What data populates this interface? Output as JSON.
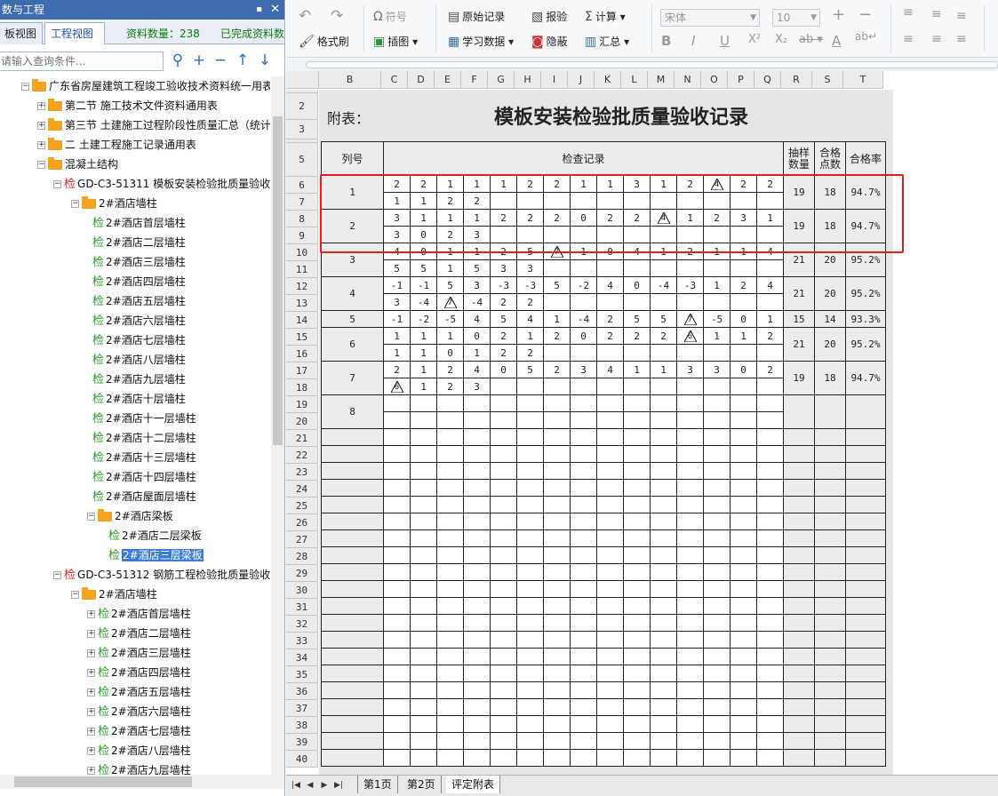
{
  "left_panel": {
    "title": "数与工程",
    "pin": "▪",
    "close": "✕",
    "tabs": [
      "板视图",
      "工程视图"
    ],
    "stats": [
      "资料数量：238",
      "已完成资料数"
    ],
    "search_placeholder": "请输入查询条件..."
  },
  "tree": [
    {
      "indent": 24,
      "type": "folder",
      "toggle": "−",
      "label": "广东省房屋建筑工程竣工验收技术资料统一用表"
    },
    {
      "indent": 42,
      "type": "folder",
      "toggle": "+",
      "label": "第二节 施工技术文件资料通用表"
    },
    {
      "indent": 42,
      "type": "folder",
      "toggle": "+",
      "label": "第三节 土建施工过程阶段性质量汇总（统计"
    },
    {
      "indent": 42,
      "type": "folder",
      "toggle": "+",
      "label": "二 土建工程施工记录通用表"
    },
    {
      "indent": 42,
      "type": "folder",
      "toggle": "−",
      "label": "混凝土结构"
    },
    {
      "indent": 60,
      "type": "jianr",
      "toggle": "−",
      "label": "GD-C3-51311 模板安装检验批质量验收记"
    },
    {
      "indent": 80,
      "type": "folder",
      "toggle": "−",
      "label": "2#酒店墙柱"
    },
    {
      "indent": 104,
      "type": "jian",
      "toggle": "",
      "label": "2#酒店首层墙柱"
    },
    {
      "indent": 104,
      "type": "jian",
      "toggle": "",
      "label": "2#酒店二层墙柱"
    },
    {
      "indent": 104,
      "type": "jian",
      "toggle": "",
      "label": "2#酒店三层墙柱"
    },
    {
      "indent": 104,
      "type": "jian",
      "toggle": "",
      "label": "2#酒店四层墙柱"
    },
    {
      "indent": 104,
      "type": "jian",
      "toggle": "",
      "label": "2#酒店五层墙柱"
    },
    {
      "indent": 104,
      "type": "jian",
      "toggle": "",
      "label": "2#酒店六层墙柱"
    },
    {
      "indent": 104,
      "type": "jian",
      "toggle": "",
      "label": "2#酒店七层墙柱"
    },
    {
      "indent": 104,
      "type": "jian",
      "toggle": "",
      "label": "2#酒店八层墙柱"
    },
    {
      "indent": 104,
      "type": "jian",
      "toggle": "",
      "label": "2#酒店九层墙柱"
    },
    {
      "indent": 104,
      "type": "jian",
      "toggle": "",
      "label": "2#酒店十层墙柱"
    },
    {
      "indent": 104,
      "type": "jian",
      "toggle": "",
      "label": "2#酒店十一层墙柱"
    },
    {
      "indent": 104,
      "type": "jian",
      "toggle": "",
      "label": "2#酒店十二层墙柱"
    },
    {
      "indent": 104,
      "type": "jian",
      "toggle": "",
      "label": "2#酒店十三层墙柱"
    },
    {
      "indent": 104,
      "type": "jian",
      "toggle": "",
      "label": "2#酒店十四层墙柱"
    },
    {
      "indent": 104,
      "type": "jian",
      "toggle": "",
      "label": "2#酒店屋面层墙柱"
    },
    {
      "indent": 98,
      "type": "folder",
      "toggle": "−",
      "label": "2#酒店梁板"
    },
    {
      "indent": 122,
      "type": "jian",
      "toggle": "",
      "label": "2#酒店二层梁板"
    },
    {
      "indent": 122,
      "type": "jian",
      "toggle": "",
      "label": "2#酒店三层梁板",
      "selected": true
    },
    {
      "indent": 60,
      "type": "jianr",
      "toggle": "−",
      "label": "GD-C3-51312 钢筋工程检验批质量验收记"
    },
    {
      "indent": 80,
      "type": "folder",
      "toggle": "−",
      "label": "2#酒店墙柱"
    },
    {
      "indent": 98,
      "type": "jian",
      "toggle": "+",
      "label": "2#酒店首层墙柱"
    },
    {
      "indent": 98,
      "type": "jian",
      "toggle": "+",
      "label": "2#酒店二层墙柱"
    },
    {
      "indent": 98,
      "type": "jian",
      "toggle": "+",
      "label": "2#酒店三层墙柱"
    },
    {
      "indent": 98,
      "type": "jian",
      "toggle": "+",
      "label": "2#酒店四层墙柱"
    },
    {
      "indent": 98,
      "type": "jian",
      "toggle": "+",
      "label": "2#酒店五层墙柱"
    },
    {
      "indent": 98,
      "type": "jian",
      "toggle": "+",
      "label": "2#酒店六层墙柱"
    },
    {
      "indent": 98,
      "type": "jian",
      "toggle": "+",
      "label": "2#酒店七层墙柱"
    },
    {
      "indent": 98,
      "type": "jian",
      "toggle": "+",
      "label": "2#酒店八层墙柱"
    },
    {
      "indent": 98,
      "type": "jian",
      "toggle": "+",
      "label": "2#酒店九层墙柱"
    }
  ],
  "toolbar": {
    "symbol": "符号",
    "format_brush": "格式刷",
    "insert_image": "插图",
    "raw_record": "原始记录",
    "study_data": "学习数据",
    "report": "报验",
    "hide": "隐蔽",
    "calculate": "计算",
    "summary": "汇总",
    "font": "宋体",
    "font_size": "10"
  },
  "sheet": {
    "columns": [
      "B",
      "C",
      "D",
      "E",
      "F",
      "G",
      "H",
      "I",
      "J",
      "K",
      "L",
      "M",
      "N",
      "O",
      "P",
      "Q",
      "R",
      "S",
      "T"
    ],
    "attach_label": "附表：",
    "title": "模板安装检验批质量验收记录",
    "hdr_col": "列号",
    "hdr_record": "检查记录",
    "hdr_sample": "抽样数量",
    "hdr_pass": "合格点数",
    "hdr_rate": "合格率",
    "groups": [
      {
        "id": "1",
        "r1": [
          "2",
          "2",
          "1",
          "1",
          "1",
          "2",
          "2",
          "1",
          "1",
          "3",
          "1",
          "2",
          "4*",
          "2",
          "2"
        ],
        "r2": [
          "1",
          "1",
          "2",
          "2"
        ],
        "sample": "19",
        "pass": "18",
        "rate": "94.7%"
      },
      {
        "id": "2",
        "r1": [
          "3",
          "1",
          "1",
          "1",
          "2",
          "2",
          "2",
          "0",
          "2",
          "2",
          "4*",
          "1",
          "2",
          "3",
          "1"
        ],
        "r2": [
          "3",
          "0",
          "2",
          "3"
        ],
        "sample": "19",
        "pass": "18",
        "rate": "94.7%"
      },
      {
        "id": "3",
        "r1": [
          "4",
          "0",
          "1",
          "1",
          "2",
          "5",
          "7*",
          "1",
          "0",
          "4",
          "1",
          "2",
          "1",
          "1",
          "4"
        ],
        "r2": [
          "5",
          "5",
          "1",
          "5",
          "3",
          "3"
        ],
        "sample": "21",
        "pass": "20",
        "rate": "95.2%"
      },
      {
        "id": "4",
        "r1": [
          "-1",
          "-1",
          "5",
          "3",
          "-3",
          "-3",
          "5",
          "-2",
          "4",
          "0",
          "-4",
          "-3",
          "1",
          "2",
          "4"
        ],
        "r2": [
          "3",
          "-4",
          "7*",
          "-4",
          "2",
          "2"
        ],
        "sample": "21",
        "pass": "20",
        "rate": "95.2%"
      },
      {
        "id": "5",
        "r1": [
          "-1",
          "-2",
          "-5",
          "4",
          "5",
          "4",
          "1",
          "-4",
          "2",
          "5",
          "5",
          "7*",
          "-5",
          "0",
          "1"
        ],
        "r2": null,
        "sample": "15",
        "pass": "14",
        "rate": "93.3%"
      },
      {
        "id": "6",
        "r1": [
          "1",
          "1",
          "1",
          "0",
          "2",
          "1",
          "2",
          "0",
          "2",
          "2",
          "2",
          "6*",
          "1",
          "1",
          "2"
        ],
        "r2": [
          "1",
          "1",
          "0",
          "1",
          "2",
          "2"
        ],
        "sample": "21",
        "pass": "20",
        "rate": "95.2%"
      },
      {
        "id": "7",
        "r1": [
          "2",
          "1",
          "2",
          "4",
          "0",
          "5",
          "2",
          "3",
          "4",
          "1",
          "1",
          "3",
          "3",
          "0",
          "2"
        ],
        "r2": [
          "6*",
          "1",
          "2",
          "3"
        ],
        "sample": "19",
        "pass": "18",
        "rate": "94.7%"
      },
      {
        "id": "8",
        "r1": [],
        "r2": [],
        "sample": "",
        "pass": "",
        "rate": ""
      }
    ]
  },
  "sheet_tabs": [
    "第1页",
    "第2页",
    "评定附表"
  ]
}
